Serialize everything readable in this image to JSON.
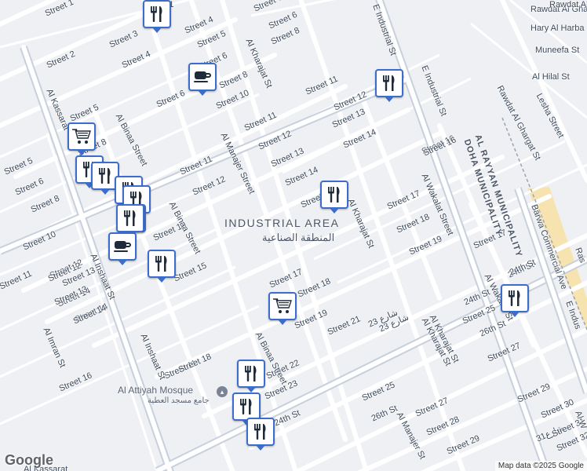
{
  "district": {
    "name_en": "INDUSTRIAL AREA",
    "name_ar": "المنطقة الصناعية"
  },
  "municipality": {
    "line1": "AL RAYYAN MUNICIPALITY",
    "line2": "DOHA MUNICIPALITY"
  },
  "mosque": {
    "name_en": "Al Attiyah Mosque",
    "name_ar": "جامع مسجد العطية"
  },
  "google_logo": "Google",
  "attribution": "Map data ©2025 Google",
  "colors": {
    "pin_border": "#3d6dcc",
    "road": "#ffffff",
    "highway": "#c7d0dc",
    "commercial": "#f6e3b0",
    "background": "#eef0f3"
  },
  "street_labels": [
    "Street 1",
    "Street 2",
    "Street 3",
    "Street 4",
    "Street 4",
    "Street 5",
    "Street 6",
    "Street 6",
    "Street 7",
    "Street 8",
    "Street 8",
    "Al Kharajat St",
    "Street 10",
    "Street 11",
    "Street 12",
    "Street 13",
    "Street 14",
    "Street 5",
    "Street 6",
    "Street 8",
    "Street 8",
    "Street 6",
    "Street 5",
    "Al Kassarat",
    "Al Binaa Street",
    "Street 11",
    "Al Manajer Street",
    "Street 11",
    "Street 12",
    "Street 13",
    "Street 14",
    "Street 15",
    "Street 16",
    "Street 12",
    "Street 13",
    "Street 14",
    "Street 14",
    "Street 10",
    "Street 11",
    "Street 12",
    "Street 13",
    "Al Binaa Street",
    "Street 15",
    "Al Inshaat St",
    "Street 12",
    "Street 13",
    "Street 14",
    "Al Imran St",
    "Street 11",
    "Street 16",
    "Al Inshaat St",
    "Street 18",
    "Street 17",
    "Street 18",
    "Street 19",
    "Street 21",
    "شارع 23",
    "Al Kharajat St",
    "Street 17",
    "Street 18",
    "Street 19",
    "Al Wakalat Street",
    "Al Kharajat St",
    "Street 16",
    "Street 17",
    "Street 22",
    "Al Binaa Street",
    "Street 23",
    "24th St",
    "Street 25",
    "26th St",
    "Street 27",
    "Street 28",
    "Street 29",
    "Al Manajer St",
    "Street 29",
    "Street 30",
    "شارع31",
    "Street 31",
    "Street 32",
    "24th St",
    "Al Wakalat St",
    "24th St",
    "Street 25",
    "26th St",
    "Street 27",
    "Al Kharajat St",
    "Rawdat Al Ghaith St",
    "Hary Al Harba St",
    "Muneefa St",
    "Al Hilal St",
    "Lesha Street",
    "Rawdat Al Ghargat St",
    "Barwa Commercial Ave",
    "E Industrial St",
    "E Industrial St",
    "Al Kassarat",
    "شارع 23",
    "Ras",
    "E Indus",
    "Rawdat Al",
    "24th St",
    "Al W",
    "Street 1"
  ],
  "markers": [
    {
      "type": "restaurant-icon"
    },
    {
      "type": "cafe-icon"
    },
    {
      "type": "restaurant-icon"
    },
    {
      "type": "shopping-cart-icon"
    },
    {
      "type": "restaurant-icon"
    },
    {
      "type": "restaurant-icon"
    },
    {
      "type": "restaurant-icon"
    },
    {
      "type": "restaurant-icon"
    },
    {
      "type": "restaurant-icon"
    },
    {
      "type": "restaurant-icon"
    },
    {
      "type": "cafe-icon"
    },
    {
      "type": "restaurant-icon"
    },
    {
      "type": "restaurant-icon"
    },
    {
      "type": "shopping-cart-icon"
    },
    {
      "type": "restaurant-icon"
    },
    {
      "type": "restaurant-icon"
    },
    {
      "type": "restaurant-icon"
    },
    {
      "type": "restaurant-icon"
    }
  ]
}
